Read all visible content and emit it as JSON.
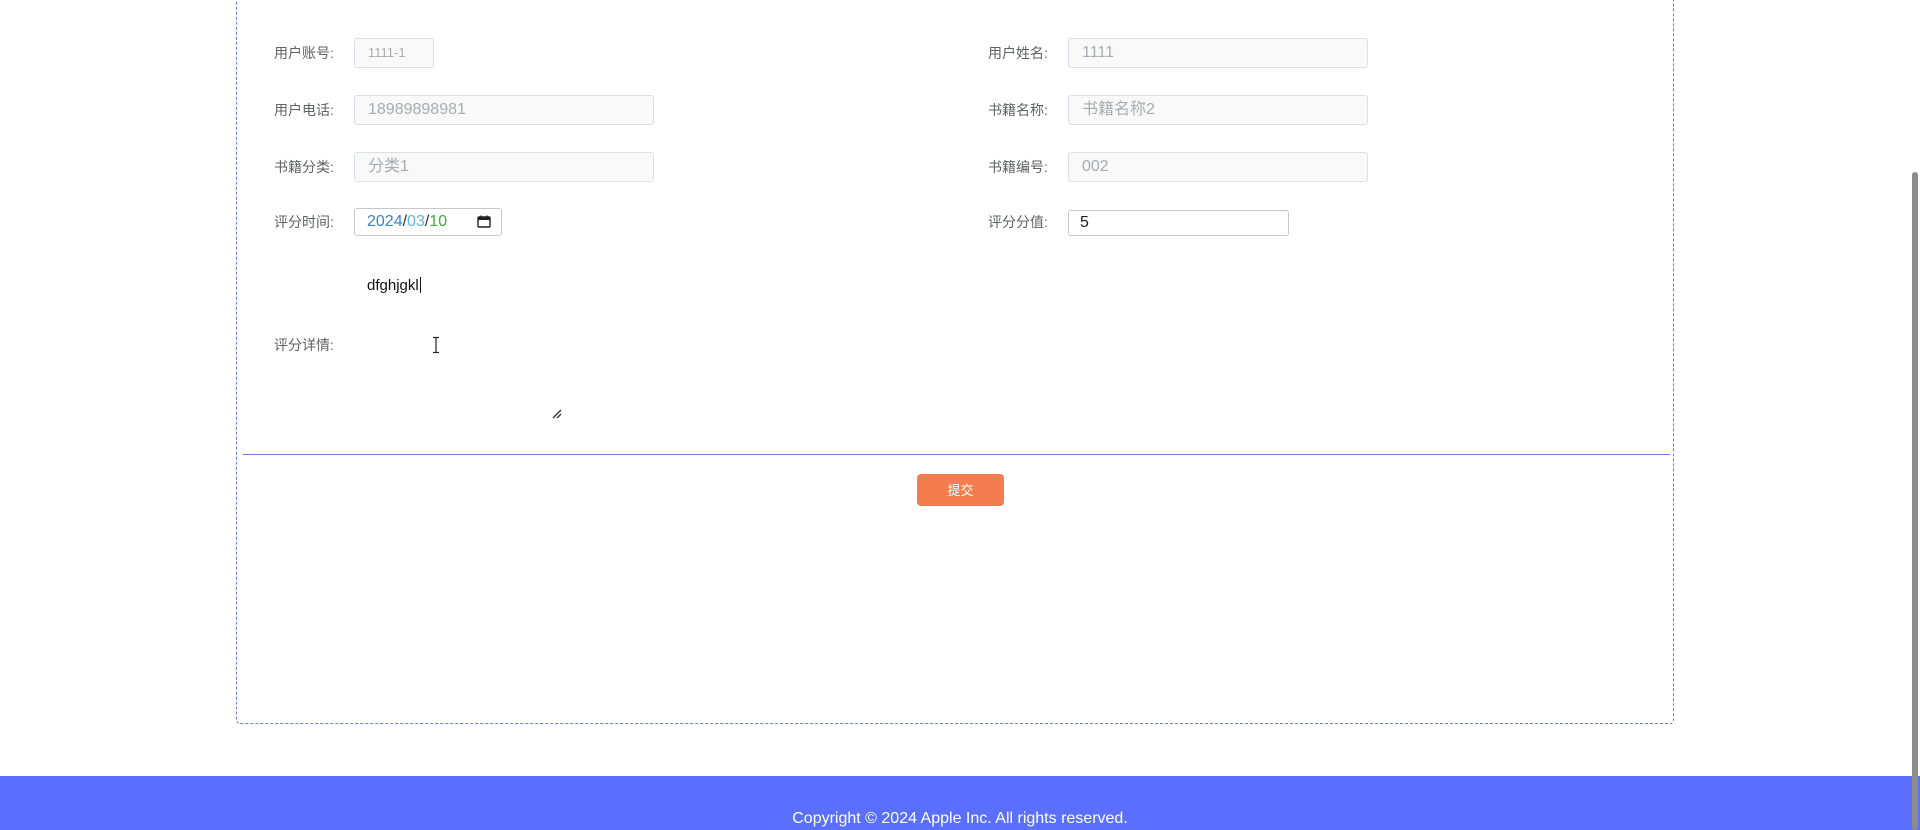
{
  "form": {
    "user_account": {
      "label": "用户账号:",
      "value": "1111-1"
    },
    "user_name": {
      "label": "用户姓名:",
      "value": "1111"
    },
    "user_phone": {
      "label": "用户电话:",
      "value": "18989898981"
    },
    "book_name": {
      "label": "书籍名称:",
      "value": "书籍名称2"
    },
    "book_category": {
      "label": "书籍分类:",
      "value": "分类1"
    },
    "book_number": {
      "label": "书籍编号:",
      "value": "002"
    },
    "rating_time": {
      "label": "评分时间:",
      "year": "2024",
      "month": "03",
      "day": "10",
      "separator": "/"
    },
    "rating_score": {
      "label": "评分分值:",
      "value": "5"
    },
    "rating_detail": {
      "label": "评分详情:",
      "value": "dfghjgkl"
    }
  },
  "submit_label": "提交",
  "footer": {
    "copyright": "Copyright © 2024 Apple Inc. All rights reserved."
  },
  "colors": {
    "primary": "#5a6ffe",
    "submit": "#f47d4f",
    "border_dashed": "#6a7bd8"
  },
  "icons": [
    "calendar-icon",
    "resize-handle-icon",
    "text-cursor-icon"
  ]
}
